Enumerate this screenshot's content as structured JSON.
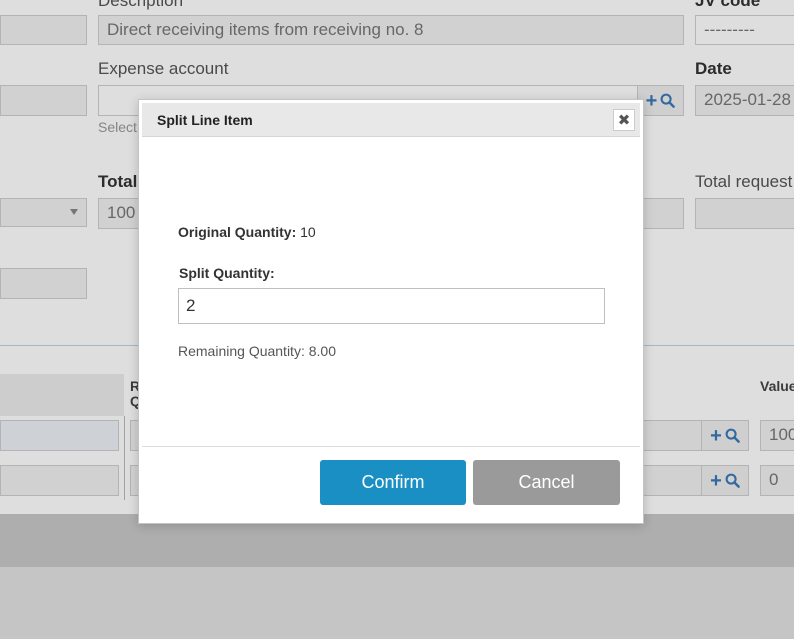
{
  "form": {
    "description_label": "Description",
    "description_value": "Direct receiving items from receiving no. 8",
    "jv_code_label": "JV code",
    "jv_code_value": "---------",
    "expense_account_label": "Expense account",
    "expense_account_hint": "Select",
    "date_label": "Date",
    "date_value": "2025-01-28",
    "total_label": "Total",
    "total_value": "100",
    "total_requested_label": "Total request"
  },
  "table": {
    "col_r_head": "R",
    "col_q_head": "Q",
    "col_value_head": "Value",
    "rows": [
      {
        "value": "100"
      },
      {
        "value": "0"
      }
    ]
  },
  "modal": {
    "title": "Split Line Item",
    "original_quantity_label": "Original Quantity:",
    "original_quantity_value": "10",
    "split_quantity_label": "Split Quantity:",
    "split_quantity_value": "2",
    "remaining_text": "Remaining Quantity: 8.00",
    "confirm_label": "Confirm",
    "cancel_label": "Cancel"
  },
  "colors": {
    "confirm_bg": "#1a8fc4",
    "cancel_bg": "#9a9a9a",
    "icon_blue": "#3a7ab8"
  }
}
